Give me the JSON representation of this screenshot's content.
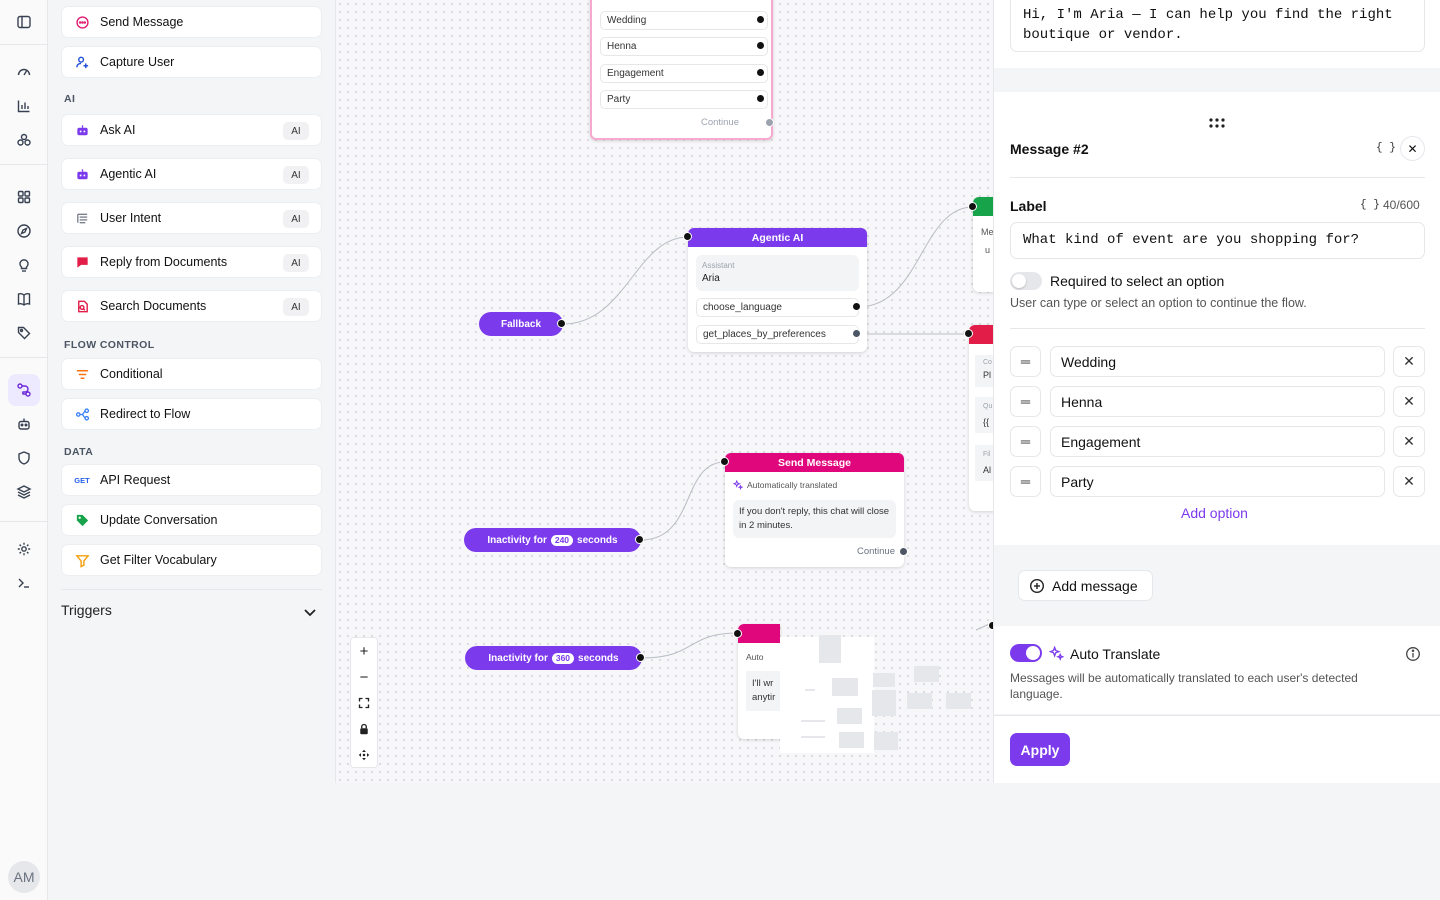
{
  "rail": {
    "items": [
      "sidebar-toggle-icon",
      "gauge-icon",
      "bar-chart-icon",
      "cluster-icon",
      "grid-icon",
      "compass-icon",
      "lightbulb-icon",
      "book-icon",
      "tag-icon",
      "flow-icon",
      "bot-icon",
      "shield-icon",
      "layers-icon",
      "settings-icon",
      "terminal-icon"
    ],
    "avatar": "AM"
  },
  "palette": {
    "top_items": [
      {
        "label": "Send Message",
        "icon": "chat-bubble-icon",
        "color": "#e11d74"
      },
      {
        "label": "Capture User",
        "icon": "user-plus-icon",
        "color": "#1d4ed8"
      }
    ],
    "ai_title": "AI",
    "ai_items": [
      {
        "label": "Ask AI",
        "badge": "AI",
        "color": "#7c3aed"
      },
      {
        "label": "Agentic AI",
        "badge": "AI",
        "color": "#7c3aed"
      },
      {
        "label": "User Intent",
        "badge": "AI",
        "color": "#6b7280"
      },
      {
        "label": "Reply from Documents",
        "badge": "AI",
        "color": "#e11d48"
      },
      {
        "label": "Search Documents",
        "badge": "AI",
        "color": "#e11d48"
      }
    ],
    "flow_title": "FLOW CONTROL",
    "flow_items": [
      {
        "label": "Conditional",
        "color": "#f97316"
      },
      {
        "label": "Redirect to Flow",
        "color": "#3b82f6"
      }
    ],
    "data_title": "DATA",
    "data_items": [
      {
        "label": "API Request",
        "icon_text": "GET",
        "color": "#2563eb"
      },
      {
        "label": "Update Conversation",
        "color": "#16a34a"
      },
      {
        "label": "Get Filter Vocabulary",
        "color": "#f59e0b"
      }
    ],
    "triggers": "Triggers"
  },
  "canvas": {
    "top_node": {
      "options": [
        "Wedding",
        "Henna",
        "Engagement",
        "Party"
      ],
      "continue": "Continue"
    },
    "agentic": {
      "title": "Agentic AI",
      "assistant_label": "Assistant",
      "assistant": "Aria",
      "tools": [
        "choose_language",
        "get_places_by_preferences"
      ]
    },
    "fallback": "Fallback",
    "send_msg": {
      "title": "Send Message",
      "auto": "Automatically translated",
      "text": "If you don't reply, this chat will close in 2 minutes.",
      "continue": "Continue"
    },
    "inactivity1": {
      "pre": "Inactivity for",
      "num": "240",
      "post": "seconds"
    },
    "inactivity2": {
      "pre": "Inactivity for",
      "num": "360",
      "post": "seconds"
    },
    "partial_node": {
      "auto": "Auto",
      "text1": "I'll wr",
      "text2": "anytir"
    },
    "partial_right": {
      "a": "Me",
      "b": "u",
      "c": "Co",
      "d": "Pl",
      "e": "Qu",
      "f": "{{",
      "g": "Fil",
      "h": "Al"
    }
  },
  "panel": {
    "message1_text": "Hi, I'm Aria — I can help you find the right boutique or vendor.",
    "message_title": "Message #2",
    "label_title": "Label",
    "char_count": "40/600",
    "label_value": "What kind of event are you shopping for?",
    "required_label": "Required to select an option",
    "required_hint": "User can type or select an option to continue the flow.",
    "options": [
      "Wedding",
      "Henna",
      "Engagement",
      "Party"
    ],
    "add_option": "Add option",
    "add_message": "Add message",
    "auto_translate": "Auto Translate",
    "auto_translate_hint": "Messages will be automatically translated to each user's detected language.",
    "apply": "Apply",
    "braces": "{ }"
  },
  "colors": {
    "accent": "#7c3aed",
    "pink": "#e0077d",
    "crimson": "#e11d48",
    "green": "#16a34a"
  }
}
